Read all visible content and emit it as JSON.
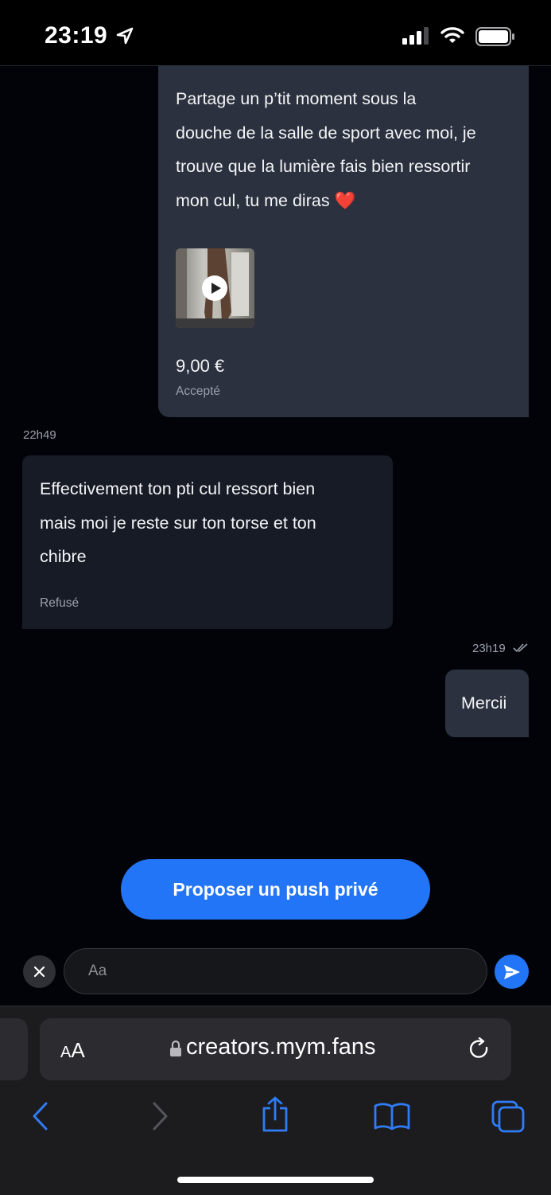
{
  "status_bar": {
    "time": "23:19",
    "icons": [
      "location-arrow-icon",
      "signal-icon",
      "wifi-icon",
      "battery-icon"
    ]
  },
  "chat": {
    "messages": [
      {
        "direction": "outgoing",
        "text": "Partage un p’tit moment sous la\ndouche de la salle de sport avec moi, je\ntrouve que la lumière fais bien ressortir\nmon cul, tu me diras",
        "emoji": "❤️",
        "has_video": true,
        "price": "9,00 €",
        "status": "Accepté"
      },
      {
        "direction": "incoming",
        "timestamp": "22h49",
        "text": "Effectivement ton pti cul ressort bien\nmais moi je reste sur ton torse et ton\nchibre",
        "status": "Refusé"
      },
      {
        "direction": "outgoing",
        "timestamp": "23h19",
        "read": true,
        "text": "Mercii"
      }
    ]
  },
  "actions": {
    "push_button_label": "Proposer un push privé"
  },
  "composer": {
    "placeholder": "Aa"
  },
  "browser": {
    "text_size_label_small": "A",
    "text_size_label_large": "A",
    "url": "creators.mym.fans"
  },
  "colors": {
    "accent": "#2275f7",
    "outgoing_bubble": "#2b313e",
    "incoming_bubble": "#171b26",
    "background": "#020309"
  }
}
